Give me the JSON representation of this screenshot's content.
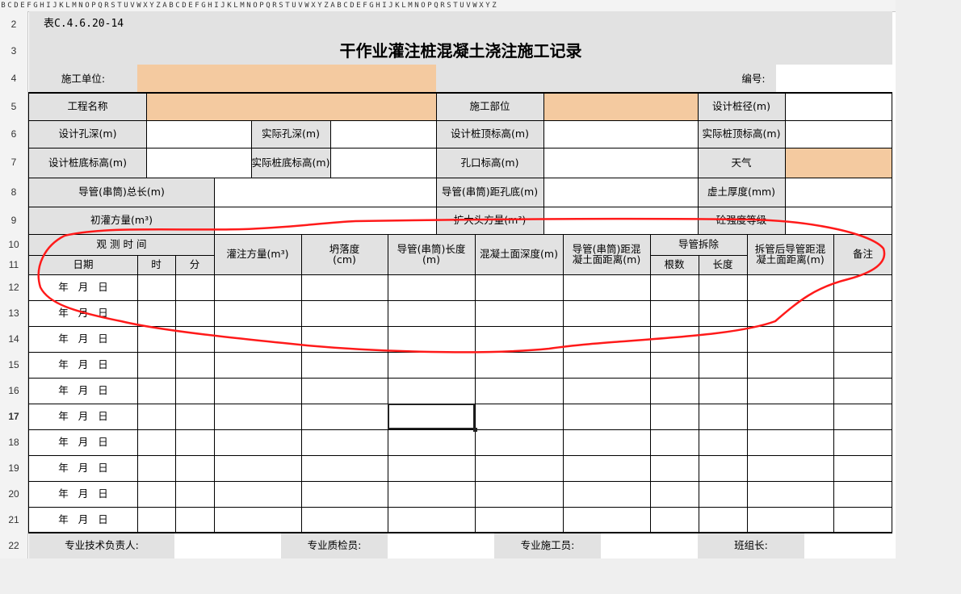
{
  "column_letters": [
    "B",
    "C",
    "D",
    "E",
    "F",
    "G",
    "H",
    "I",
    "J",
    "K",
    "L",
    "M",
    "N",
    "O",
    "P",
    "Q",
    "R",
    "S",
    "T",
    "U",
    "V",
    "W",
    "X",
    "Y",
    "Z",
    "A",
    "B",
    "C",
    "D",
    "E",
    "F",
    "G",
    "H",
    "I",
    "J",
    "K",
    "L",
    "M",
    "N",
    "O",
    "P",
    "Q",
    "R",
    "S",
    "T",
    "U",
    "V",
    "W",
    "X",
    "Y",
    "Z",
    "A",
    "B",
    "C",
    "D",
    "E",
    "F",
    "G",
    "H",
    "I",
    "J",
    "K",
    "L",
    "M",
    "N",
    "O",
    "P",
    "Q",
    "R",
    "S",
    "T",
    "U",
    "V",
    "W",
    "X",
    "Y",
    "Z"
  ],
  "row_numbers": [
    "2",
    "3",
    "4",
    "5",
    "6",
    "7",
    "8",
    "9",
    "10",
    "11",
    "12",
    "13",
    "14",
    "15",
    "16",
    "17",
    "18",
    "19",
    "20",
    "21",
    "22"
  ],
  "selected_row": "17",
  "form": {
    "table_no": "表C.4.6.20-14",
    "title": "干作业灌注桩混凝土浇注施工记录",
    "construction_unit": "施工单位:",
    "number_label": "编号:",
    "project_name": "工程名称",
    "construction_part": "施工部位",
    "design_pile_dia": "设计桩径(m)",
    "design_hole_depth": "设计孔深(m)",
    "actual_hole_depth": "实际孔深(m)",
    "design_pile_top": "设计桩顶标高(m)",
    "actual_pile_top": "实际桩顶标高(m)",
    "design_pile_bottom": "设计桩底标高(m)",
    "actual_pile_bottom": "实际桩底标高(m)",
    "hole_mouth": "孔口标高(m)",
    "weather": "天气",
    "pipe_total": "导管(串筒)总长(m)",
    "pipe_to_bottom": "导管(串筒)距孔底(m)",
    "loose_soil": "虚土厚度(mm)",
    "initial_pour": "初灌方量(m³)",
    "enlarged_head": "扩大头方量(m³)",
    "concrete_grade": "砼强度等级",
    "obs_time": "观 测 时 间",
    "date": "日期",
    "hour": "时",
    "minute": "分",
    "pour_volume": "灌注方量(m³)",
    "slump": "坍落度\n(cm)",
    "pipe_length": "导管(串筒)长度\n(m)",
    "concrete_depth": "混凝土面深度(m)",
    "pipe_to_concrete": "导管(串筒)距混\n凝土面距离(m)",
    "pipe_removal": "导管拆除",
    "count": "根数",
    "length": "长度",
    "after_removal": "拆管后导管距混\n凝土面距离(m)",
    "remarks": "备注",
    "year": "年",
    "month": "月",
    "day": "日",
    "tech_lead": "专业技术负责人:",
    "qc": "专业质检员:",
    "constructor": "专业施工员:",
    "team_lead": "班组长:"
  },
  "colors": {
    "label_fill": "#e2e2e2",
    "input_fill": "#f4caa0",
    "annotation": "#ff1a1a"
  }
}
